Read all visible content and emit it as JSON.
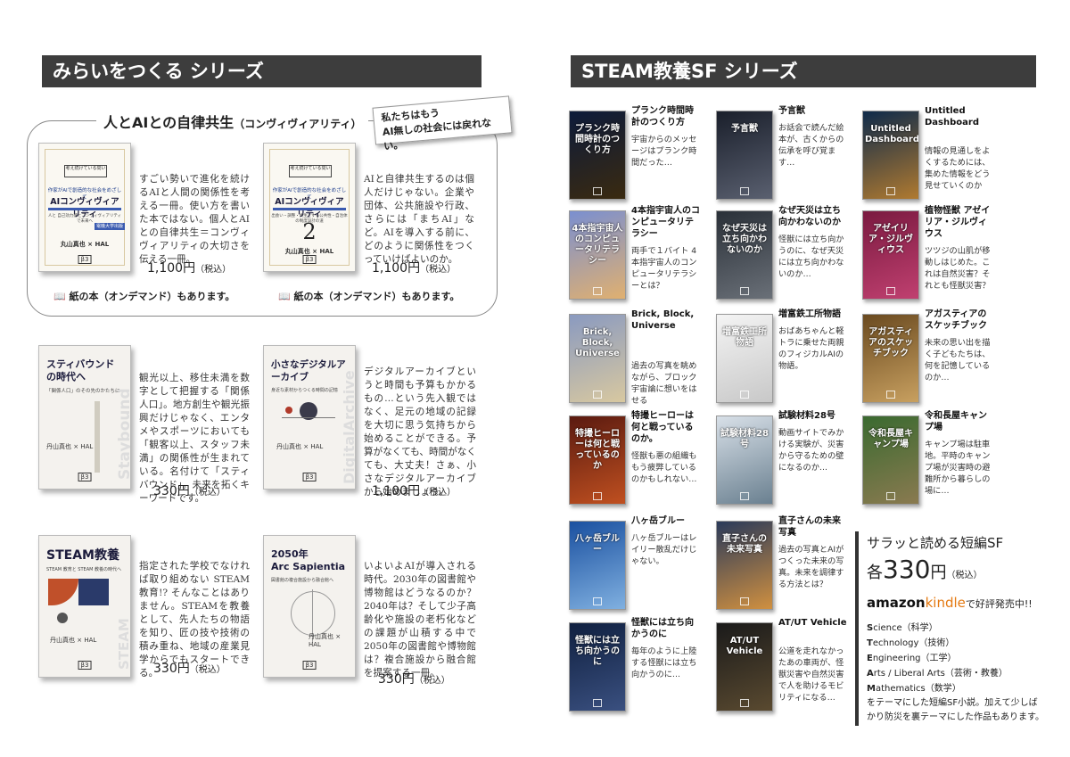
{
  "left": {
    "header": "みらいをつくる シリーズ",
    "group_title": "人とAIとの自律共生",
    "group_title_sub": "（コンヴィヴィアリティ）",
    "note_lines": [
      "私たちはもう",
      "AI無しの社会には戻れない。"
    ],
    "book1": {
      "cover_top1": "作家がAIで創造的な社会をめざして",
      "cover_top2": "考え続けている問い",
      "cover_title": "AIコンヴィヴィアリティ",
      "cover_sub": "人と 自己効力感とコンヴィヴィアリティで未来へ",
      "cover_badge": "電機大学出版",
      "cover_author": "丸山真也 × HAL",
      "desc": "すごい勢いで進化を続けるAIと人間の関係性を考える一冊。使い方を書いた本ではない。個人とAIとの自律共生＝コンヴィヴィアリティの大切さを伝える一冊。",
      "price": "1,100円",
      "tax": "（税込）"
    },
    "book2": {
      "cover_top1": "作家がAIで創造的な社会をめざして",
      "cover_top2": "考え続けている問い",
      "cover_title": "AIコンヴィヴィアリティ",
      "cover_sub": "出会い・調整・共生とする公共性・自治体の制度設計の道",
      "cover_num": "2",
      "cover_author": "丸山真也 × HAL",
      "desc": "AIと自律共生するのは個人だけじゃない。企業や団体、公共施設や行政、さらには「まちAI」など。AIを導入する前に、どのように関係性をつくっていけばよいのか。",
      "price": "1,100円",
      "tax": "（税込）"
    },
    "paper_note1": "📖 紙の本（オンデマンド）もあります。",
    "paper_note2": "📖 紙の本（オンデマンド）もあります。",
    "book3": {
      "cover_title": "スティバウンドの時代へ",
      "cover_sub": "「関係人口」のその先のかたちに",
      "cover_author": "丹山真也 × HAL",
      "watermark": "Staybound",
      "desc": "観光以上、移住未満を数字として把握する「関係人口」。地方創生や観光振興だけじゃなく、エンタメやスポーツにおいても「観客以上、スタッフ未満」の関係性が生まれている。名付けて「スティバウンド」。未来を拓くキーワードです。",
      "price": "330円",
      "tax": "（税込）"
    },
    "book4": {
      "cover_title": "小さなデジタルアーカイブ",
      "cover_sub": "身近な素材からつくる時間の記憶",
      "cover_author": "丹山真也 × HAL",
      "watermark": "DigitalArchive",
      "desc": "デジタルアーカイブというと時間も予算もかかるもの…という先入観ではなく、足元の地域の記録を大切に思う気持ちから始めることができる。予算がなくても、時間がなくても、大丈夫！さぁ、小さなデジタルアーカイブから始めましょう。",
      "price": "1,100円",
      "tax": "（税込）"
    },
    "book5": {
      "cover_title": "STEAM教養",
      "cover_sub": "STEAM 教育と STEAM 教養の時代へ",
      "cover_author": "丹山真也 × HAL",
      "watermark": "STEAM Studies",
      "desc": "指定された学校でなければ取り組めない STEAM教育!? そんなことはありません。STEAMを教養として、先人たちの物語を知り、匠の技や技術の積み重ね、地域の産業見学からでもスタートできる。",
      "price": "330円",
      "tax": "（税込）"
    },
    "book6": {
      "cover_title1": "2050年",
      "cover_title2": "Arc Sapientia",
      "cover_sub": "図書館の複合施設から融合館へ",
      "cover_author": "丹山真也 × HAL",
      "desc": "いよいよAIが導入される時代。2030年の図書館や博物館はどうなるのか？2040年は？そして少子高齢化や施設の老朽化などの課題が山積する中で2050年の図書館や博物館は？複合施設から融合館を提案する一冊。",
      "price": "330円",
      "tax": "（税込）"
    }
  },
  "right": {
    "header": "STEAM教養SF シリーズ",
    "books": [
      {
        "title": "プランク時間時計のつくり方",
        "desc": "宇宙からのメッセージはプランク時間だった…",
        "cover_text": "プランク時間時計のつくり方",
        "color1": "#0d1b3a",
        "color2": "#3a2a10"
      },
      {
        "title": "予言獣",
        "desc": "お話会で読んだ絵本が、古くからの伝承を呼び覚ます…",
        "cover_text": "予言獣",
        "color1": "#1a1f2b",
        "color2": "#5a6070"
      },
      {
        "title": "Untitled Dashboard",
        "desc": "情報の見通しをよくするためには、集めた情報をどう見せていくのか",
        "cover_text": "Untitled Dashboard",
        "color1": "#0e2a4a",
        "color2": "#b07a30"
      },
      {
        "title": "4本指宇宙人のコンピュータリテラシー",
        "desc": "両手で１バイト 4本指宇宙人のコンピュータリテラシーとは？",
        "cover_text": "4本指宇宙人のコンピュータリテラシー",
        "color1": "#7a8fd0",
        "color2": "#e0b070"
      },
      {
        "title": "なぜ天災は立ち向かわないのか",
        "desc": "怪獣には立ち向かうのに、なぜ天災には立ち向かわないのか…",
        "cover_text": "なぜ天災は立ち向かわないのか",
        "color1": "#2a3038",
        "color2": "#6a7078"
      },
      {
        "title": "植物怪獣 アゼイリア・ジルヴィウス",
        "desc": "ツツジの山肌が移動しはじめた。これは自然災害？それとも怪獣災害？",
        "cover_text": "アゼイリア・ジルヴィウス",
        "color1": "#7a1a40",
        "color2": "#c04070"
      },
      {
        "title": "Brick, Block, Universe",
        "desc": "過去の写真を眺めながら、ブロック宇宙論に想いをはせる",
        "cover_text": "Brick, Block, Universe",
        "color1": "#8a9ac0",
        "color2": "#d8c8a0"
      },
      {
        "title": "増富鉄工所物語",
        "desc": "おばあちゃんと軽トラに乗せた両親のフィジカルAIの物語。",
        "cover_text": "増富鉄工所物語",
        "color1": "#f4f4f4",
        "color2": "#c8c8c8"
      },
      {
        "title": "アガスティアのスケッチブック",
        "desc": "未来の思い出を描く子どもたちは、何を記憶しているのか…",
        "cover_text": "アガスティアのスケッチブック",
        "color1": "#6a4a20",
        "color2": "#c8a060"
      },
      {
        "title": "特撮ヒーローは何と戦っているのか。",
        "desc": "怪獣も悪の組織ももう疲弊しているのかもしれない…",
        "cover_text": "特撮ヒーローは何と戦っているのか",
        "color1": "#5a1a10",
        "color2": "#c05020"
      },
      {
        "title": "試験材料28号",
        "desc": "動画サイトでみかける実験が、災害から守るための壁になるのか…",
        "cover_text": "試験材料28号",
        "color1": "#d8e0e8",
        "color2": "#6a8090"
      },
      {
        "title": "令和長屋キャンプ場",
        "desc": "キャンプ場は駐車地。平時のキャンプ場が災害時の避難所から暮らしの場に…",
        "cover_text": "令和長屋キャンプ場",
        "color1": "#3a6a30",
        "color2": "#8a7a50"
      },
      {
        "title": "八ヶ岳ブルー",
        "desc": "八ヶ岳ブルーはレイリー散乱だけじゃない。",
        "cover_text": "八ヶ岳ブルー",
        "color1": "#1a50a0",
        "color2": "#80b0e0"
      },
      {
        "title": "直子さんの未来写真",
        "desc": "過去の写真とAIがつくった未来の写真。未来を調律する方法とは？",
        "cover_text": "直子さんの未来写真",
        "color1": "#2a3a5a",
        "color2": "#d09040"
      },
      {
        "title": "怪獣には立ち向かうのに",
        "desc": "毎年のように上陸する怪獣には立ち向かうのに…",
        "cover_text": "怪獣には立ち向かうのに",
        "color1": "#102040",
        "color2": "#3a5080"
      },
      {
        "title": "AT/UT Vehicle",
        "desc": "公道を走れなかったあの車両が、怪獣災害や自然災害で人を助けるモビリティになる…",
        "cover_text": "AT/UT Vehicle",
        "color1": "#1a1a1a",
        "color2": "#5a4a30"
      }
    ],
    "promo": {
      "headline": "サラッと読める短編SF",
      "price_prefix": "各",
      "price": "330",
      "price_unit": "円",
      "tax": "（税込）",
      "amazon": "amazon",
      "kindle": "kindle",
      "kindle_suffix": "で好評発売中!!",
      "fields": [
        {
          "initial": "S",
          "rest": "cience（科学）"
        },
        {
          "initial": "T",
          "rest": "echnology（技術）"
        },
        {
          "initial": "E",
          "rest": "ngineering（工学）"
        },
        {
          "initial": "A",
          "rest": "rts / Liberal Arts（芸術・教養）"
        },
        {
          "initial": "M",
          "rest": "athematics（数学）"
        }
      ],
      "footer": "をテーマにした短編SF小説。加えて少しばかり防災を裏テーマにした作品もあります。"
    }
  }
}
